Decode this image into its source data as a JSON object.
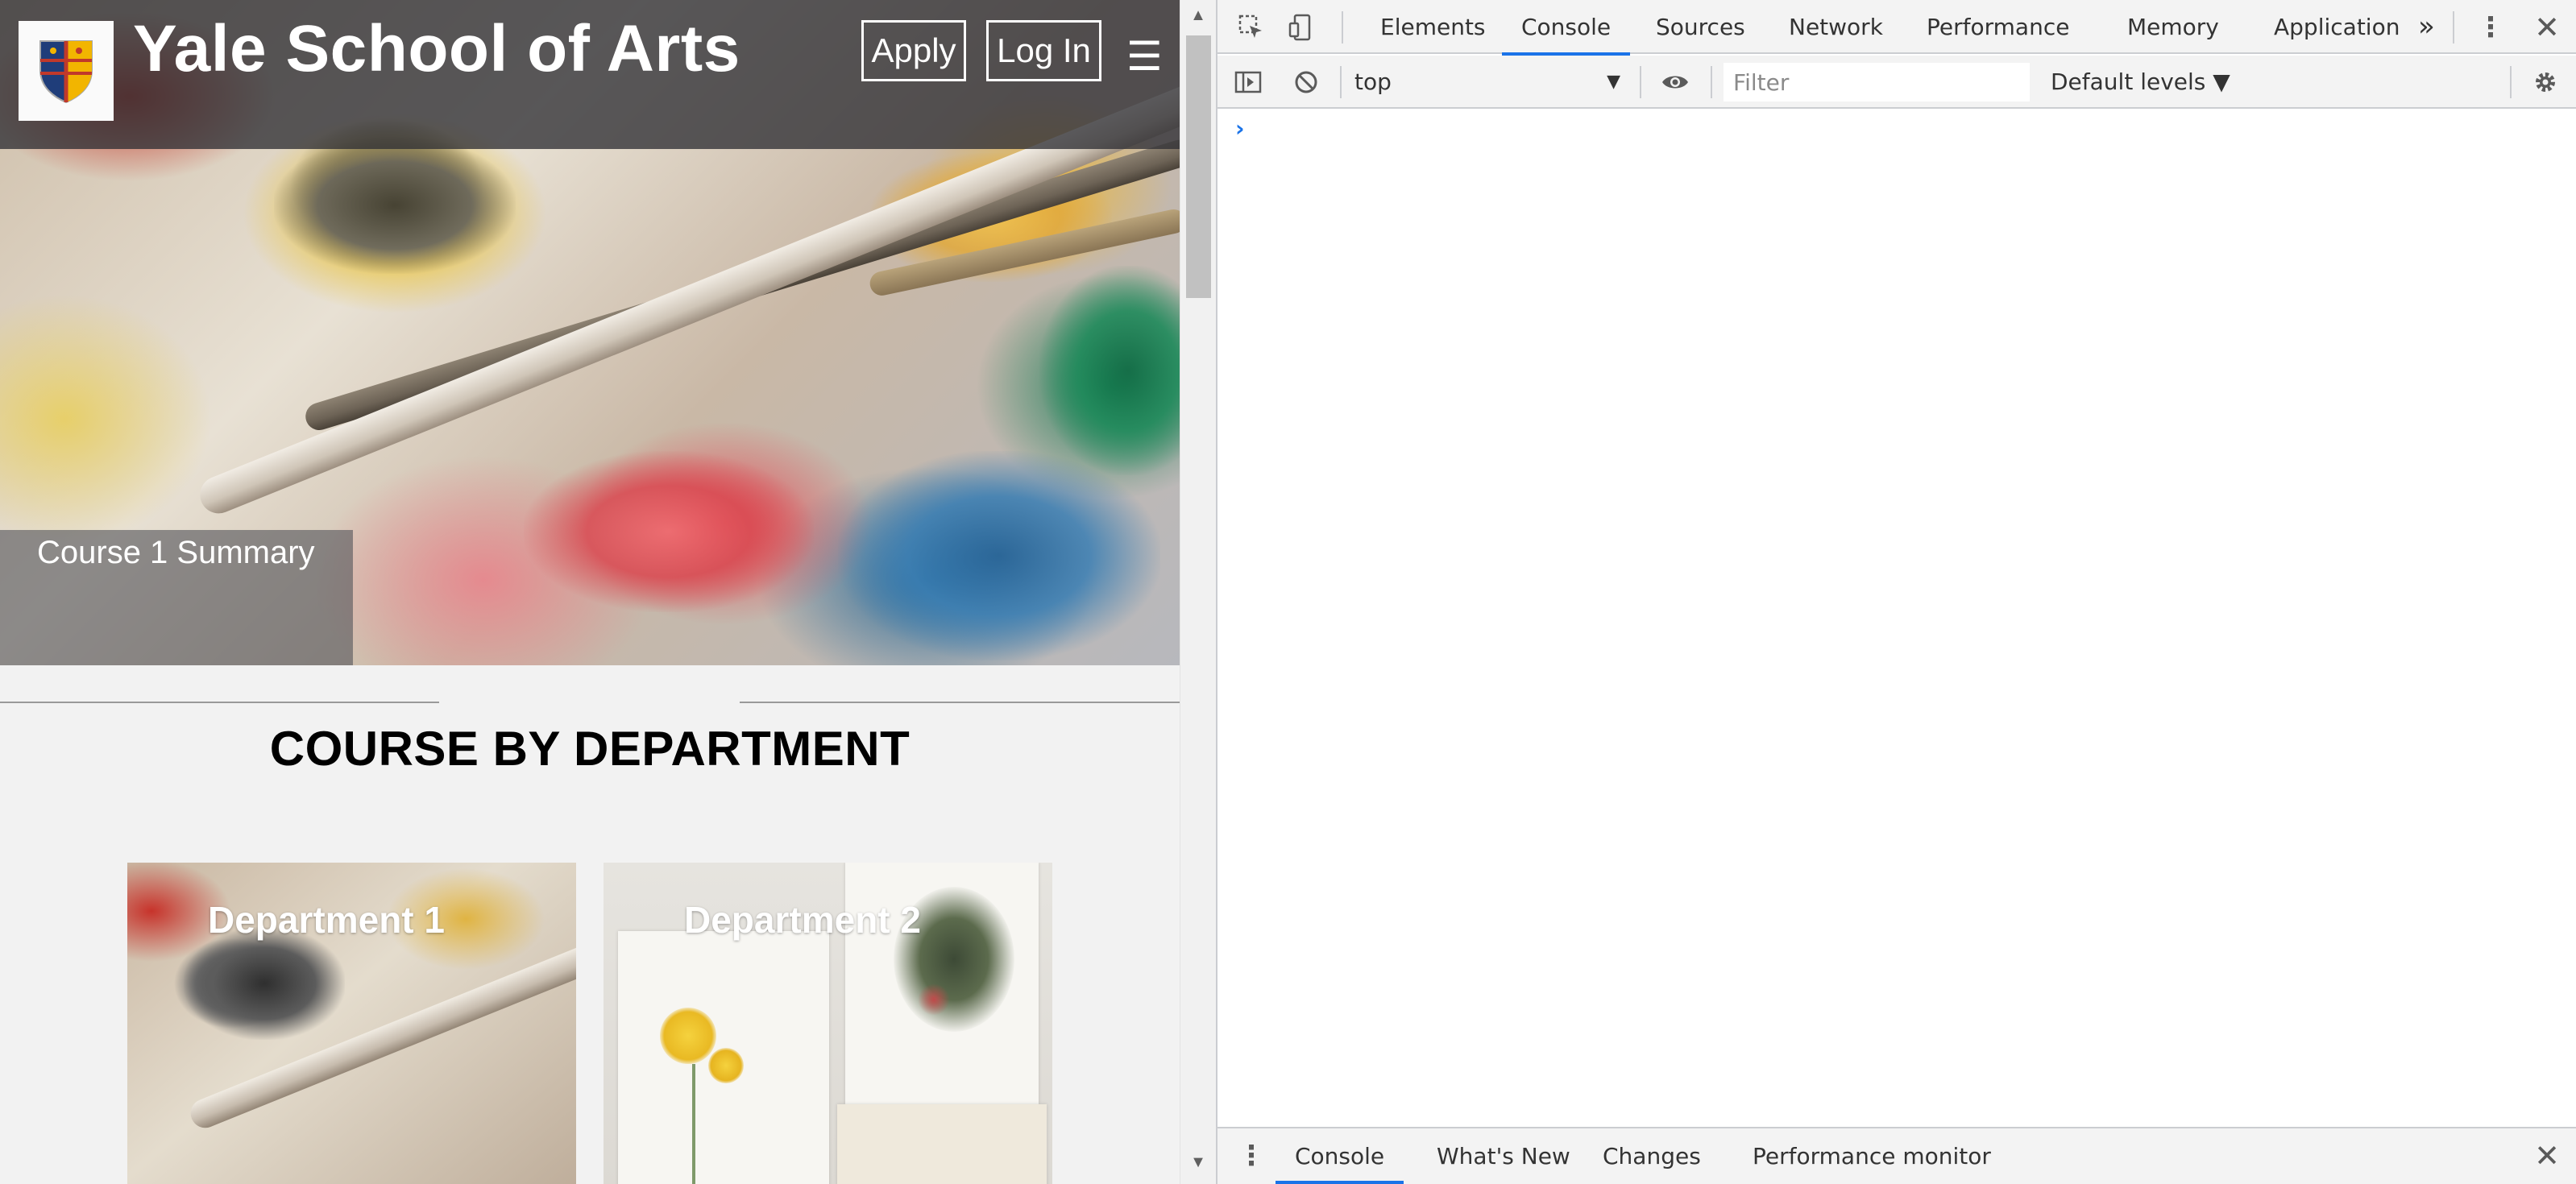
{
  "site": {
    "title": "Yale School of Arts",
    "apply_label": "Apply",
    "login_label": "Log In",
    "menu_icon": "hamburger-menu-icon",
    "menu_glyph": "☰",
    "hero_caption": "Course 1 Summary",
    "section_heading": "COURSE BY DEPARTMENT",
    "departments": [
      {
        "label": "Department 1"
      },
      {
        "label": "Department 2"
      }
    ],
    "colors": {
      "topbar": "#303034",
      "background": "#f2f2f2",
      "text_on_dark": "#ffffff"
    }
  },
  "devtools": {
    "tabs": [
      "Elements",
      "Console",
      "Sources",
      "Network",
      "Performance",
      "Memory",
      "Application"
    ],
    "active_tab": "Console",
    "overflow_glyph": "»",
    "context": "top",
    "filter_placeholder": "Filter",
    "levels": "Default levels ▼",
    "console_prompt": "›",
    "drawer": {
      "tabs": [
        "Console",
        "What's New",
        "Changes",
        "Performance monitor"
      ],
      "active_tab": "Console"
    },
    "colors": {
      "accent": "#1a73e8",
      "toolbar": "#f3f3f3",
      "border": "#cbcdd1"
    }
  }
}
